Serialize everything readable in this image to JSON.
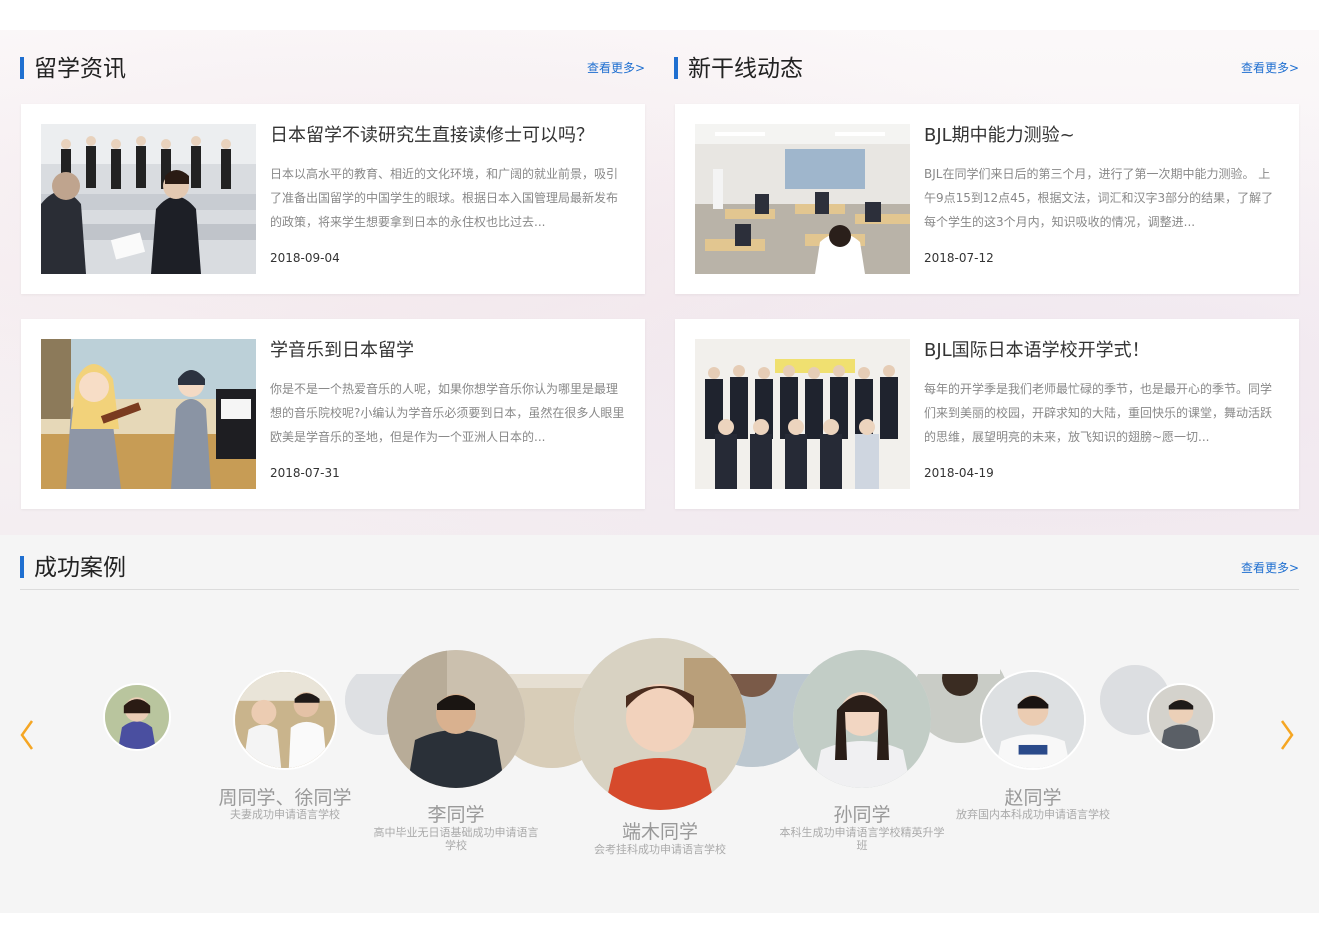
{
  "study_news": {
    "title": "留学资讯",
    "more": "查看更多>",
    "items": [
      {
        "title": "日本留学不读研究生直接读修士可以吗？",
        "desc": "日本以高水平的教育、相近的文化环境，和广阔的就业前景，吸引了准备出国留学的中国学生的眼球。根据日本入国管理局最新发布的政策，将来学生想要拿到日本的永住权也比过去...",
        "date": "2018-09-04"
      },
      {
        "title": "学音乐到日本留学",
        "desc": "你是不是一个热爱音乐的人呢，如果你想学音乐你认为哪里是最理想的音乐院校呢?小编认为学音乐必须要到日本，虽然在很多人眼里欧美是学音乐的圣地，但是作为一个亚洲人日本的...",
        "date": "2018-07-31"
      }
    ]
  },
  "school_news": {
    "title": "新干线动态",
    "more": "查看更多>",
    "items": [
      {
        "title": "BJL期中能力测验~",
        "desc": "BJL在同学们来日后的第三个月，进行了第一次期中能力测验。 上午9点15到12点45，根据文法，词汇和汉字3部分的结果，了解了每个学生的这3个月内，知识吸收的情况，调整进...",
        "date": "2018-07-12"
      },
      {
        "title": "BJL国际日本语学校开学式！",
        "desc": "每年的开学季是我们老师最忙碌的季节，也是最开心的季节。同学们来到美丽的校园，开辟求知的大陆，重回快乐的课堂，舞动活跃的思维，展望明亮的未来，放飞知识的翅膀~愿一切...",
        "date": "2018-04-19"
      }
    ]
  },
  "cases": {
    "title": "成功案例",
    "more": "查看更多>",
    "students": [
      {
        "name": "周同学、徐同学",
        "desc": "夫妻成功申请语言学校"
      },
      {
        "name": "李同学",
        "desc": "高中毕业无日语基础成功申请语言学校"
      },
      {
        "name": "端木同学",
        "desc": "会考挂科成功申请语言学校"
      },
      {
        "name": "孙同学",
        "desc": "本科生成功申请语言学校精英升学班"
      },
      {
        "name": "赵同学",
        "desc": "放弃国内本科成功申请语言学校"
      }
    ],
    "prev_icon": "chevron-left-icon",
    "next_icon": "chevron-right-icon",
    "accent": "#f5a623"
  },
  "colors": {
    "primary": "#1f6fd0"
  }
}
